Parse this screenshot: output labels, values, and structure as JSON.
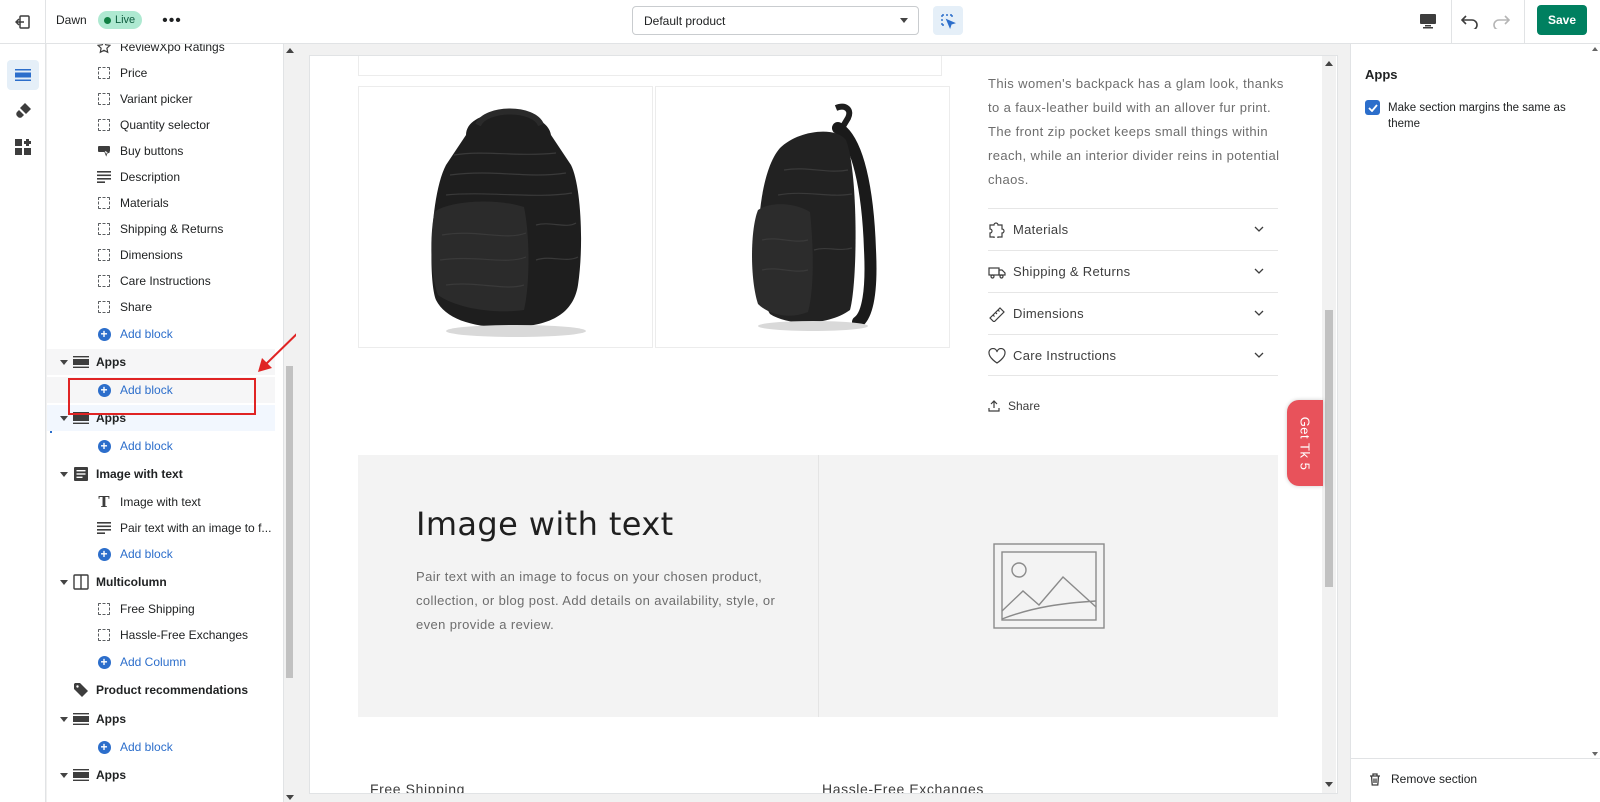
{
  "topbar": {
    "theme_name": "Dawn",
    "status_badge": "Live",
    "template_select": "Default product",
    "save_label": "Save"
  },
  "sections_panel": {
    "rows": [
      {
        "kind": "block",
        "label": "ReviewXpo Ratings",
        "icon": "star-icon"
      },
      {
        "kind": "block",
        "label": "Price",
        "icon": "dashed-block-icon"
      },
      {
        "kind": "block",
        "label": "Variant picker",
        "icon": "dashed-block-icon"
      },
      {
        "kind": "block",
        "label": "Quantity selector",
        "icon": "dashed-block-icon"
      },
      {
        "kind": "block",
        "label": "Buy buttons",
        "icon": "cursor-button-icon"
      },
      {
        "kind": "block",
        "label": "Description",
        "icon": "text-lines-icon"
      },
      {
        "kind": "block",
        "label": "Materials",
        "icon": "dashed-block-icon"
      },
      {
        "kind": "block",
        "label": "Shipping & Returns",
        "icon": "dashed-block-icon"
      },
      {
        "kind": "block",
        "label": "Dimensions",
        "icon": "dashed-block-icon"
      },
      {
        "kind": "block",
        "label": "Care Instructions",
        "icon": "dashed-block-icon"
      },
      {
        "kind": "block",
        "label": "Share",
        "icon": "dashed-block-icon"
      },
      {
        "kind": "add",
        "label": "Add block"
      },
      {
        "kind": "section",
        "label": "Apps"
      },
      {
        "kind": "add",
        "label": "Add block"
      },
      {
        "kind": "section",
        "label": "Apps"
      },
      {
        "kind": "add",
        "label": "Add block"
      },
      {
        "kind": "section",
        "label": "Image with text"
      },
      {
        "kind": "block",
        "label": "Image with text",
        "icon": "heading-t-icon"
      },
      {
        "kind": "block",
        "label": "Pair text with an image to f...",
        "icon": "text-lines-icon"
      },
      {
        "kind": "add",
        "label": "Add block"
      },
      {
        "kind": "section",
        "label": "Multicolumn"
      },
      {
        "kind": "block",
        "label": "Free Shipping",
        "icon": "dashed-block-icon"
      },
      {
        "kind": "block",
        "label": "Hassle-Free Exchanges",
        "icon": "dashed-block-icon"
      },
      {
        "kind": "add",
        "label": "Add Column"
      },
      {
        "kind": "section",
        "label": "Product recommendations"
      },
      {
        "kind": "section",
        "label": "Apps"
      },
      {
        "kind": "add",
        "label": "Add block"
      },
      {
        "kind": "section",
        "label": "Apps"
      }
    ]
  },
  "preview": {
    "description": "This women's backpack has a glam look, thanks to a faux-leather build with an allover fur print. The front zip pocket keeps small things within reach, while an interior divider reins in potential chaos.",
    "accordions": [
      {
        "label": "Materials",
        "icon": "puzzle-icon"
      },
      {
        "label": "Shipping & Returns",
        "icon": "truck-icon"
      },
      {
        "label": "Dimensions",
        "icon": "ruler-icon"
      },
      {
        "label": "Care Instructions",
        "icon": "heart-icon"
      }
    ],
    "share_label": "Share",
    "image_with_text": {
      "title": "Image with text",
      "text": "Pair text with an image to focus on your chosen product, collection, or blog post. Add details on availability, style, or even provide a review."
    },
    "multicolumn": {
      "col1": "Free Shipping",
      "col2": "Hassle-Free Exchanges"
    },
    "floating_tab": "Get Tk 5"
  },
  "settings_panel": {
    "title": "Apps",
    "checkbox_label": "Make section margins the same as theme",
    "checkbox_checked": true,
    "remove_label": "Remove section"
  },
  "colors": {
    "accent": "#2c6ecb",
    "save": "#008060",
    "live_badge": "#aee9d1",
    "annotation": "#e02424",
    "floating_tab": "#e8525b"
  }
}
